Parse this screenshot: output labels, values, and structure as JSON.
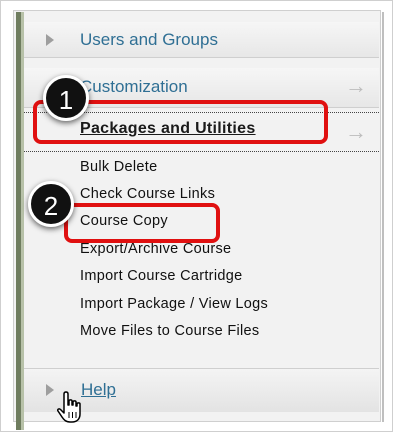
{
  "menu": {
    "users_groups": "Users and Groups",
    "customization": "Customization",
    "packages_utilities": "Packages and Utilities",
    "sub_items": [
      "Bulk Delete",
      "Check Course Links",
      "Course Copy",
      "Export/Archive Course",
      "Import Course Cartridge",
      "Import Package / View Logs",
      "Move Files to Course Files"
    ],
    "help": "Help",
    "arrow_glyph": "→"
  },
  "annotations": {
    "step1": "1",
    "step2": "2",
    "highlight_color": "#e01010"
  },
  "colors": {
    "link_blue": "#2f6f94",
    "panel_bg": "#f2f2f2"
  }
}
